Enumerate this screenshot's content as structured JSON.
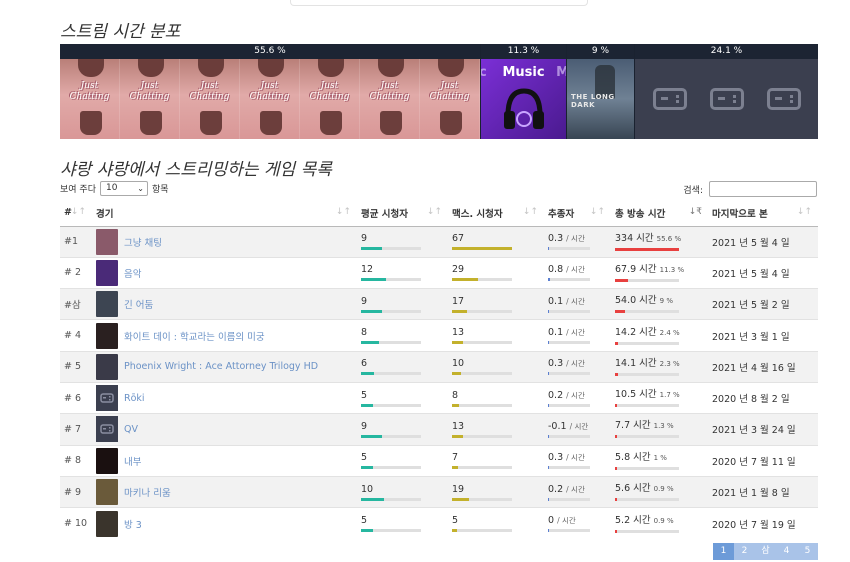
{
  "dist_title": "스트림 시간 분포",
  "distribution": [
    {
      "label": "55.6 %",
      "share": 0.556,
      "art": "Just Chatting"
    },
    {
      "label": "11.3 %",
      "share": 0.113,
      "art": "Music"
    },
    {
      "label": "9 %",
      "share": 0.09,
      "art": "THE LONG DARK"
    },
    {
      "label": "24.1 %",
      "share": 0.241,
      "art": "other"
    }
  ],
  "music_art_edges": [
    "c",
    "M"
  ],
  "list_title": "샤랑 샤랑에서 스트리밍하는 게임 목록",
  "length_control": {
    "prefix": "보여 주다",
    "value": "10",
    "suffix": "항목"
  },
  "search_label": "검색:",
  "table": {
    "columns": [
      "#",
      "경기",
      "평균 시청자",
      "맥스. 시청자",
      "추종자",
      "총 방송 시간",
      "마지막으로 본"
    ],
    "rows": [
      {
        "rank": "#1",
        "game": "그냥 채팅",
        "thumb": "chatting",
        "avg": "9",
        "avg_f": 0.35,
        "max": "67",
        "max_f": 1.0,
        "fol": "0.3",
        "fol_f": 0.03,
        "hours": "334 시간",
        "pct": "55.6 %",
        "hours_f": 1.0,
        "last": "2021 년 5 월 4 일"
      },
      {
        "rank": "# 2",
        "game": "음악",
        "thumb": "music",
        "avg": "12",
        "avg_f": 0.42,
        "max": "29",
        "max_f": 0.43,
        "fol": "0.8",
        "fol_f": 0.05,
        "hours": "67.9 시간",
        "pct": "11.3 %",
        "hours_f": 0.2,
        "last": "2021 년 5 월 4 일"
      },
      {
        "rank": "#삼",
        "game": "긴 어둠",
        "thumb": "longdark",
        "avg": "9",
        "avg_f": 0.35,
        "max": "17",
        "max_f": 0.25,
        "fol": "0.1",
        "fol_f": 0.02,
        "hours": "54.0 시간",
        "pct": "9 %",
        "hours_f": 0.16,
        "last": "2021 년 5 월 2 일"
      },
      {
        "rank": "# 4",
        "game": "화이트 데이 : 학교라는 이름의 미궁",
        "thumb": "whiteday",
        "avg": "8",
        "avg_f": 0.3,
        "max": "13",
        "max_f": 0.19,
        "fol": "0.1",
        "fol_f": 0.02,
        "hours": "14.2 시간",
        "pct": "2.4 %",
        "hours_f": 0.045,
        "last": "2021 년 3 월 1 일"
      },
      {
        "rank": "# 5",
        "game": "Phoenix Wright : Ace Attorney Trilogy HD",
        "thumb": "phoenix",
        "avg": "6",
        "avg_f": 0.22,
        "max": "10",
        "max_f": 0.15,
        "fol": "0.3",
        "fol_f": 0.03,
        "hours": "14.1 시간",
        "pct": "2.3 %",
        "hours_f": 0.045,
        "last": "2021 년 4 월 16 일"
      },
      {
        "rank": "# 6",
        "game": "Rōki",
        "thumb": "pad",
        "avg": "5",
        "avg_f": 0.2,
        "max": "8",
        "max_f": 0.12,
        "fol": "0.2",
        "fol_f": 0.03,
        "hours": "10.5 시간",
        "pct": "1.7 %",
        "hours_f": 0.035,
        "last": "2020 년 8 월 2 일"
      },
      {
        "rank": "# 7",
        "game": "QV",
        "thumb": "pad",
        "avg": "9",
        "avg_f": 0.35,
        "max": "13",
        "max_f": 0.19,
        "fol": "-0.1",
        "fol_f": 0.01,
        "hours": "7.7 시간",
        "pct": "1.3 %",
        "hours_f": 0.03,
        "last": "2021 년 3 월 24 일"
      },
      {
        "rank": "# 8",
        "game": "내부",
        "thumb": "inside",
        "avg": "5",
        "avg_f": 0.2,
        "max": "7",
        "max_f": 0.1,
        "fol": "0.3",
        "fol_f": 0.03,
        "hours": "5.8 시간",
        "pct": "1 %",
        "hours_f": 0.025,
        "last": "2020 년 7 월 11 일"
      },
      {
        "rank": "# 9",
        "game": "마키나 리움",
        "thumb": "machinarium",
        "avg": "10",
        "avg_f": 0.38,
        "max": "19",
        "max_f": 0.28,
        "fol": "0.2",
        "fol_f": 0.03,
        "hours": "5.6 시간",
        "pct": "0.9 %",
        "hours_f": 0.025,
        "last": "2021 년 1 월 8 일"
      },
      {
        "rank": "# 10",
        "game": "방 3",
        "thumb": "room",
        "avg": "5",
        "avg_f": 0.2,
        "max": "5",
        "max_f": 0.08,
        "fol": "0",
        "fol_f": 0.01,
        "hours": "5.2 시간",
        "pct": "0.9 %",
        "hours_f": 0.025,
        "last": "2020 년 7 월 19 일"
      }
    ],
    "per_hour": "/ 시간"
  },
  "pagination": [
    "1",
    "2",
    "삼",
    "4",
    "5"
  ],
  "colors": {
    "teal": "#26b7a0",
    "olive": "#c3b12c",
    "blue": "#5b7fd1",
    "red": "#e8403f",
    "link": "#6b92c6"
  },
  "thumb_colors": {
    "chatting": "#8a5a6a",
    "music": "#4a2a78",
    "longdark": "#3d4552",
    "whiteday": "#2a2020",
    "phoenix": "#3a3a48",
    "pad": "#3b3f4f",
    "inside": "#1a1010",
    "machinarium": "#6a5a3a",
    "room": "#3a342c"
  }
}
